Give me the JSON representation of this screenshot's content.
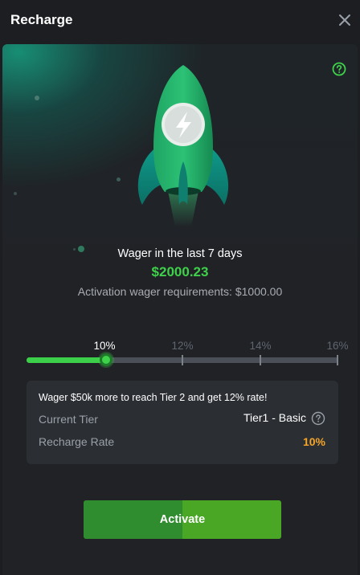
{
  "header": {
    "title": "Recharge",
    "close_icon": "close-icon"
  },
  "hero": {
    "help_icon": "question-circle-icon",
    "rocket_icon": "rocket-lightning-icon",
    "accent_color": "#3fd14a"
  },
  "wager": {
    "label": "Wager in the last 7 days",
    "amount": "$2000.23",
    "requirement": "Activation wager requirements: $1000.00"
  },
  "progress": {
    "ticks": [
      "10%",
      "12%",
      "14%",
      "16%"
    ],
    "current_index": 0,
    "fill_fraction": 0.26
  },
  "info": {
    "message": "Wager $50k more to reach Tier 2 and get 12% rate!",
    "current_tier_label": "Current Tier",
    "current_tier_value": "Tier1 - Basic",
    "recharge_rate_label": "Recharge Rate",
    "recharge_rate_value": "10%",
    "rate_color": "#f4a52a"
  },
  "actions": {
    "activate_label": "Activate"
  }
}
